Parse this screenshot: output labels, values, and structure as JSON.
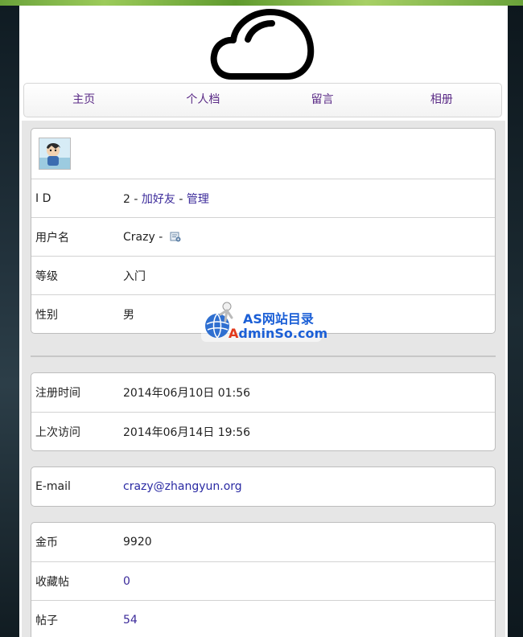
{
  "nav": {
    "items": [
      {
        "label": "主页"
      },
      {
        "label": "个人档"
      },
      {
        "label": "留言"
      },
      {
        "label": "相册"
      }
    ]
  },
  "profile": {
    "id": {
      "key": "I D",
      "value": "2",
      "sep1": " - ",
      "add_friend": "加好友",
      "sep2": " - ",
      "manage": "管理"
    },
    "username": {
      "key": "用户名",
      "value": "Crazy",
      "sep": " - "
    },
    "level": {
      "key": "等级",
      "value": "入门"
    },
    "gender": {
      "key": "性别",
      "value": "男"
    }
  },
  "times": {
    "register": {
      "key": "注册时间",
      "value": "2014年06月10日 01:56"
    },
    "last_visit": {
      "key": "上次访问",
      "value": "2014年06月14日 19:56"
    }
  },
  "contact": {
    "email": {
      "key": "E-mail",
      "value": "crazy@zhangyun.org"
    }
  },
  "stats": {
    "coins": {
      "key": "金币",
      "value": "9920"
    },
    "favorites": {
      "key": "收藏帖",
      "value": "0"
    },
    "posts": {
      "key": "帖子",
      "value": "54"
    }
  },
  "watermark": {
    "line1": "AS网站目录",
    "line2_a": "A",
    "line2_b": "dminSo.com"
  },
  "colors": {
    "link": "#3b2a9a",
    "nav_link": "#5a2a86",
    "panel_bg": "#e6e6e6"
  },
  "icons": [
    "cloud-logo-icon",
    "edit-profile-icon",
    "avatar-image",
    "globe-icon"
  ]
}
